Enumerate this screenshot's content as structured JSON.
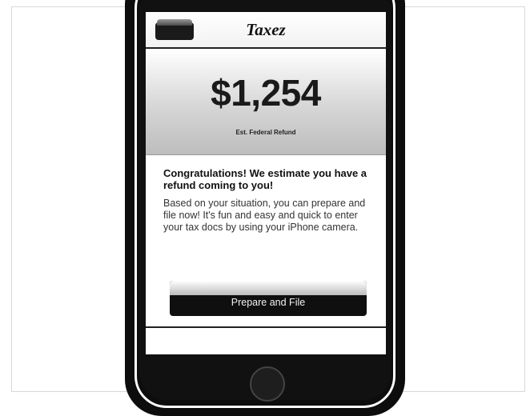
{
  "app": {
    "title": "Taxez"
  },
  "refund": {
    "amount": "$1,254",
    "label": "Est. Federal Refund"
  },
  "message": {
    "headline": "Congratulations! We estimate you have a refund coming to you!",
    "body": "Based on your situation, you can prepare and file now! It's fun and easy and quick to enter your tax docs by using your iPhone camera."
  },
  "actions": {
    "back_icon": "back-button-icon",
    "cta_label": "Prepare and File"
  }
}
